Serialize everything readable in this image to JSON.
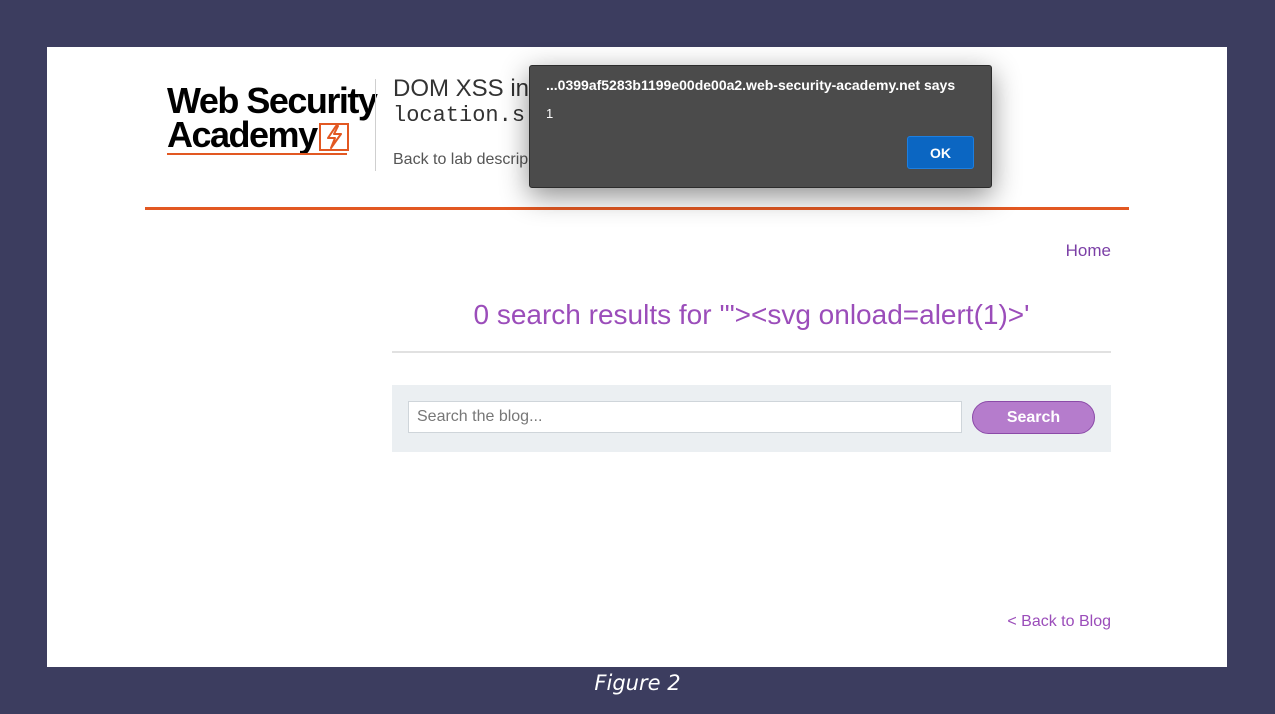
{
  "header": {
    "logo_line1": "Web Security",
    "logo_line2": "Academy",
    "lab_title_line1": "DOM XSS in",
    "lab_title_line2": "location.s",
    "back_to_lab": "Back to lab descrip"
  },
  "nav": {
    "home": "Home"
  },
  "results": {
    "title": "0 search results for '\"><svg onload=alert(1)>'"
  },
  "search": {
    "placeholder": "Search the blog...",
    "value": "",
    "button_label": "Search"
  },
  "footer": {
    "back_to_blog": "< Back to Blog"
  },
  "dialog": {
    "title": "...0399af5283b1199e00de00a2.web-security-academy.net says",
    "message": "1",
    "ok_label": "OK"
  },
  "caption": "Figure 2",
  "colors": {
    "accent_orange": "#e25822",
    "link_purple": "#9b4dba",
    "button_purple": "#b57ccc",
    "dialog_bg": "#4b4b4b",
    "dialog_ok_blue": "#0b66c2",
    "outer_bg": "#3c3d5f"
  },
  "icons": {
    "logo_mark": "lightning-bolt-icon"
  }
}
